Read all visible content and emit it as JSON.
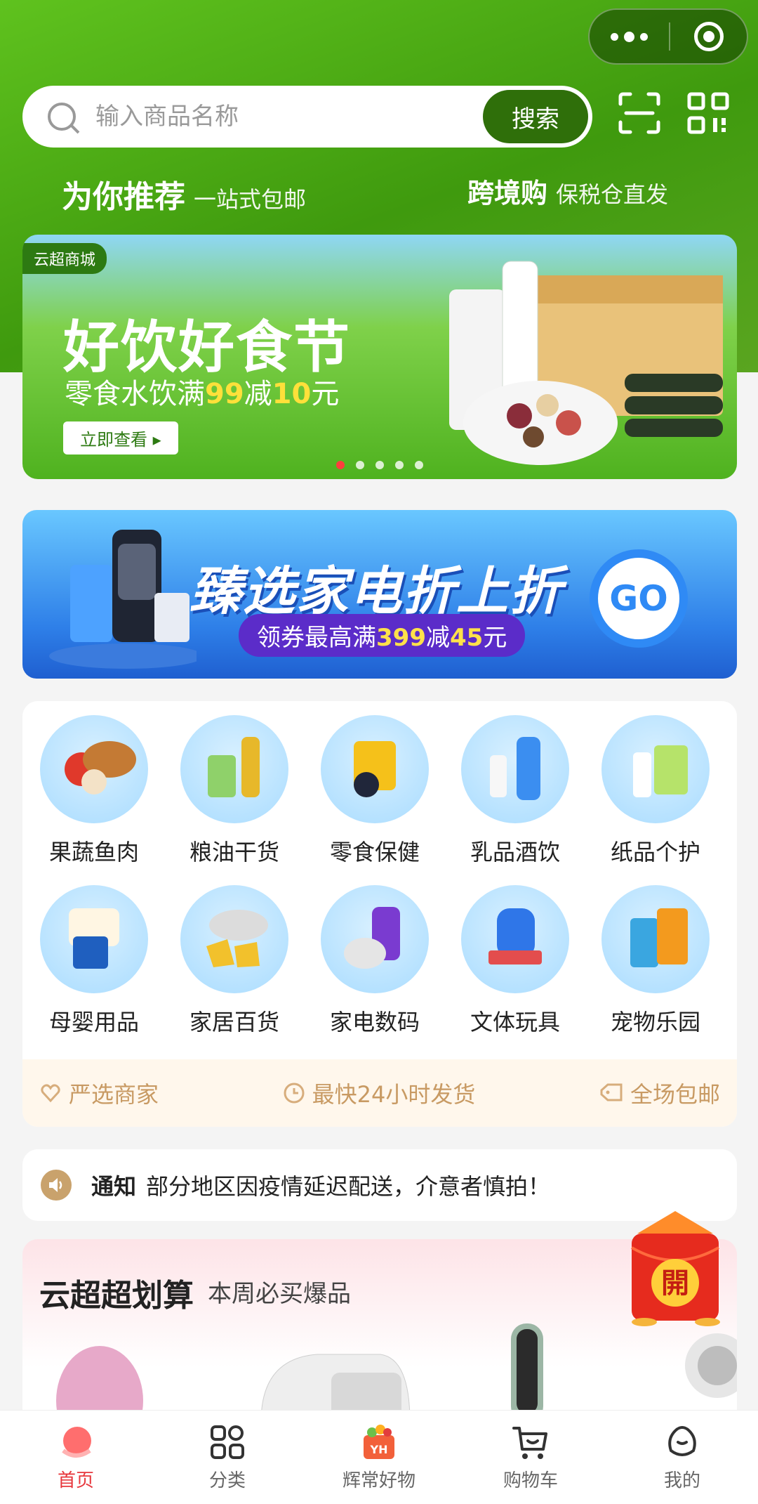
{
  "search": {
    "placeholder": "输入商品名称",
    "button": "搜索"
  },
  "header": {
    "left": {
      "title": "为你推荐",
      "subtitle": "一站式包邮"
    },
    "right": {
      "title": "跨境购",
      "subtitle": "保税仓直发"
    }
  },
  "banner": {
    "tag": "云超商城",
    "title": "好饮好食节",
    "sub_prefix": "零食水饮满",
    "sub_num1": "99",
    "sub_mid": "减",
    "sub_num2": "10",
    "sub_suffix": "元",
    "button": "立即查看",
    "slide_count": 5,
    "active_slide": 1
  },
  "promo": {
    "title": "臻选家电折上折",
    "sub_prefix": "领券最高满",
    "sub_num1": "399",
    "sub_mid": "减",
    "sub_num2": "45",
    "sub_suffix": "元",
    "go": "GO"
  },
  "categories": [
    {
      "label": "果蔬鱼肉",
      "icon": "fruit-meat-icon"
    },
    {
      "label": "粮油干货",
      "icon": "grain-oil-icon"
    },
    {
      "label": "零食保健",
      "icon": "snack-icon"
    },
    {
      "label": "乳品酒饮",
      "icon": "dairy-icon"
    },
    {
      "label": "纸品个护",
      "icon": "paper-care-icon"
    },
    {
      "label": "母婴用品",
      "icon": "baby-icon"
    },
    {
      "label": "家居百货",
      "icon": "home-goods-icon"
    },
    {
      "label": "家电数码",
      "icon": "appliance-icon"
    },
    {
      "label": "文体玩具",
      "icon": "toy-icon"
    },
    {
      "label": "宠物乐园",
      "icon": "pet-icon"
    }
  ],
  "features": [
    "严选商家",
    "最快24小时发货",
    "全场包邮"
  ],
  "notice": {
    "label": "通知",
    "text": "部分地区因疫情延迟配送，介意者慎拍！"
  },
  "deals": {
    "title": "云超超划算",
    "subtitle": "本周必买爆品"
  },
  "red_packet": {
    "label": "開"
  },
  "tabs": [
    {
      "label": "首页",
      "active": true
    },
    {
      "label": "分类",
      "active": false
    },
    {
      "label": "辉常好物",
      "active": false,
      "badge": "YH"
    },
    {
      "label": "购物车",
      "active": false
    },
    {
      "label": "我的",
      "active": false
    }
  ],
  "colors": {
    "brand_green": "#4fae16",
    "dark_green": "#2f6f0a",
    "active_red": "#e7383d",
    "feature_gold": "#c89a63"
  }
}
